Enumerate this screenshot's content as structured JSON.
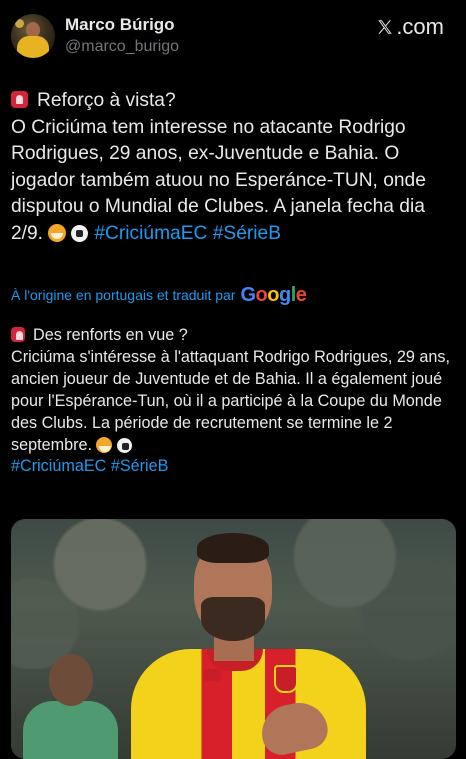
{
  "author": {
    "display_name": "Marco Búrigo",
    "handle": "@marco_burigo"
  },
  "brand": {
    "label": ".com"
  },
  "original_post": {
    "heading": "Reforço à vista?",
    "body": "O Criciúma tem interesse no atacante Rodrigo Rodrigues, 29 anos, ex-Juventude e Bahia. O jogador também atuou no Esperánce-TUN, onde disputou o Mundial de Clubes. A janela fecha dia 2/9.",
    "hashtags": [
      "#CriciúmaEC",
      "#SérieB"
    ]
  },
  "translation_notice": {
    "text": "À l'origine en portugais et traduit par",
    "provider": "Google"
  },
  "translated_post": {
    "heading": "Des renforts en vue ?",
    "body": "Criciúma s'intéresse à l'attaquant Rodrigo Rodrigues, 29 ans, ancien joueur de Juventude et de Bahia. Il a également joué pour l'Espérance-Tun, où il a participé à la Coupe du Monde des Clubs. La période de recrutement se termine le 2 septembre.",
    "hashtags": [
      "#CriciúmaEC",
      "#SérieB"
    ]
  },
  "icons": {
    "siren": "police-car-light-emoji",
    "tiger": "tiger-face-emoji",
    "ball": "soccer-ball-emoji",
    "x_logo": "x-logo-icon"
  },
  "colors": {
    "background": "#000000",
    "text": "#e7e9ea",
    "secondary_text": "#71767b",
    "link": "#1d9bf0"
  }
}
